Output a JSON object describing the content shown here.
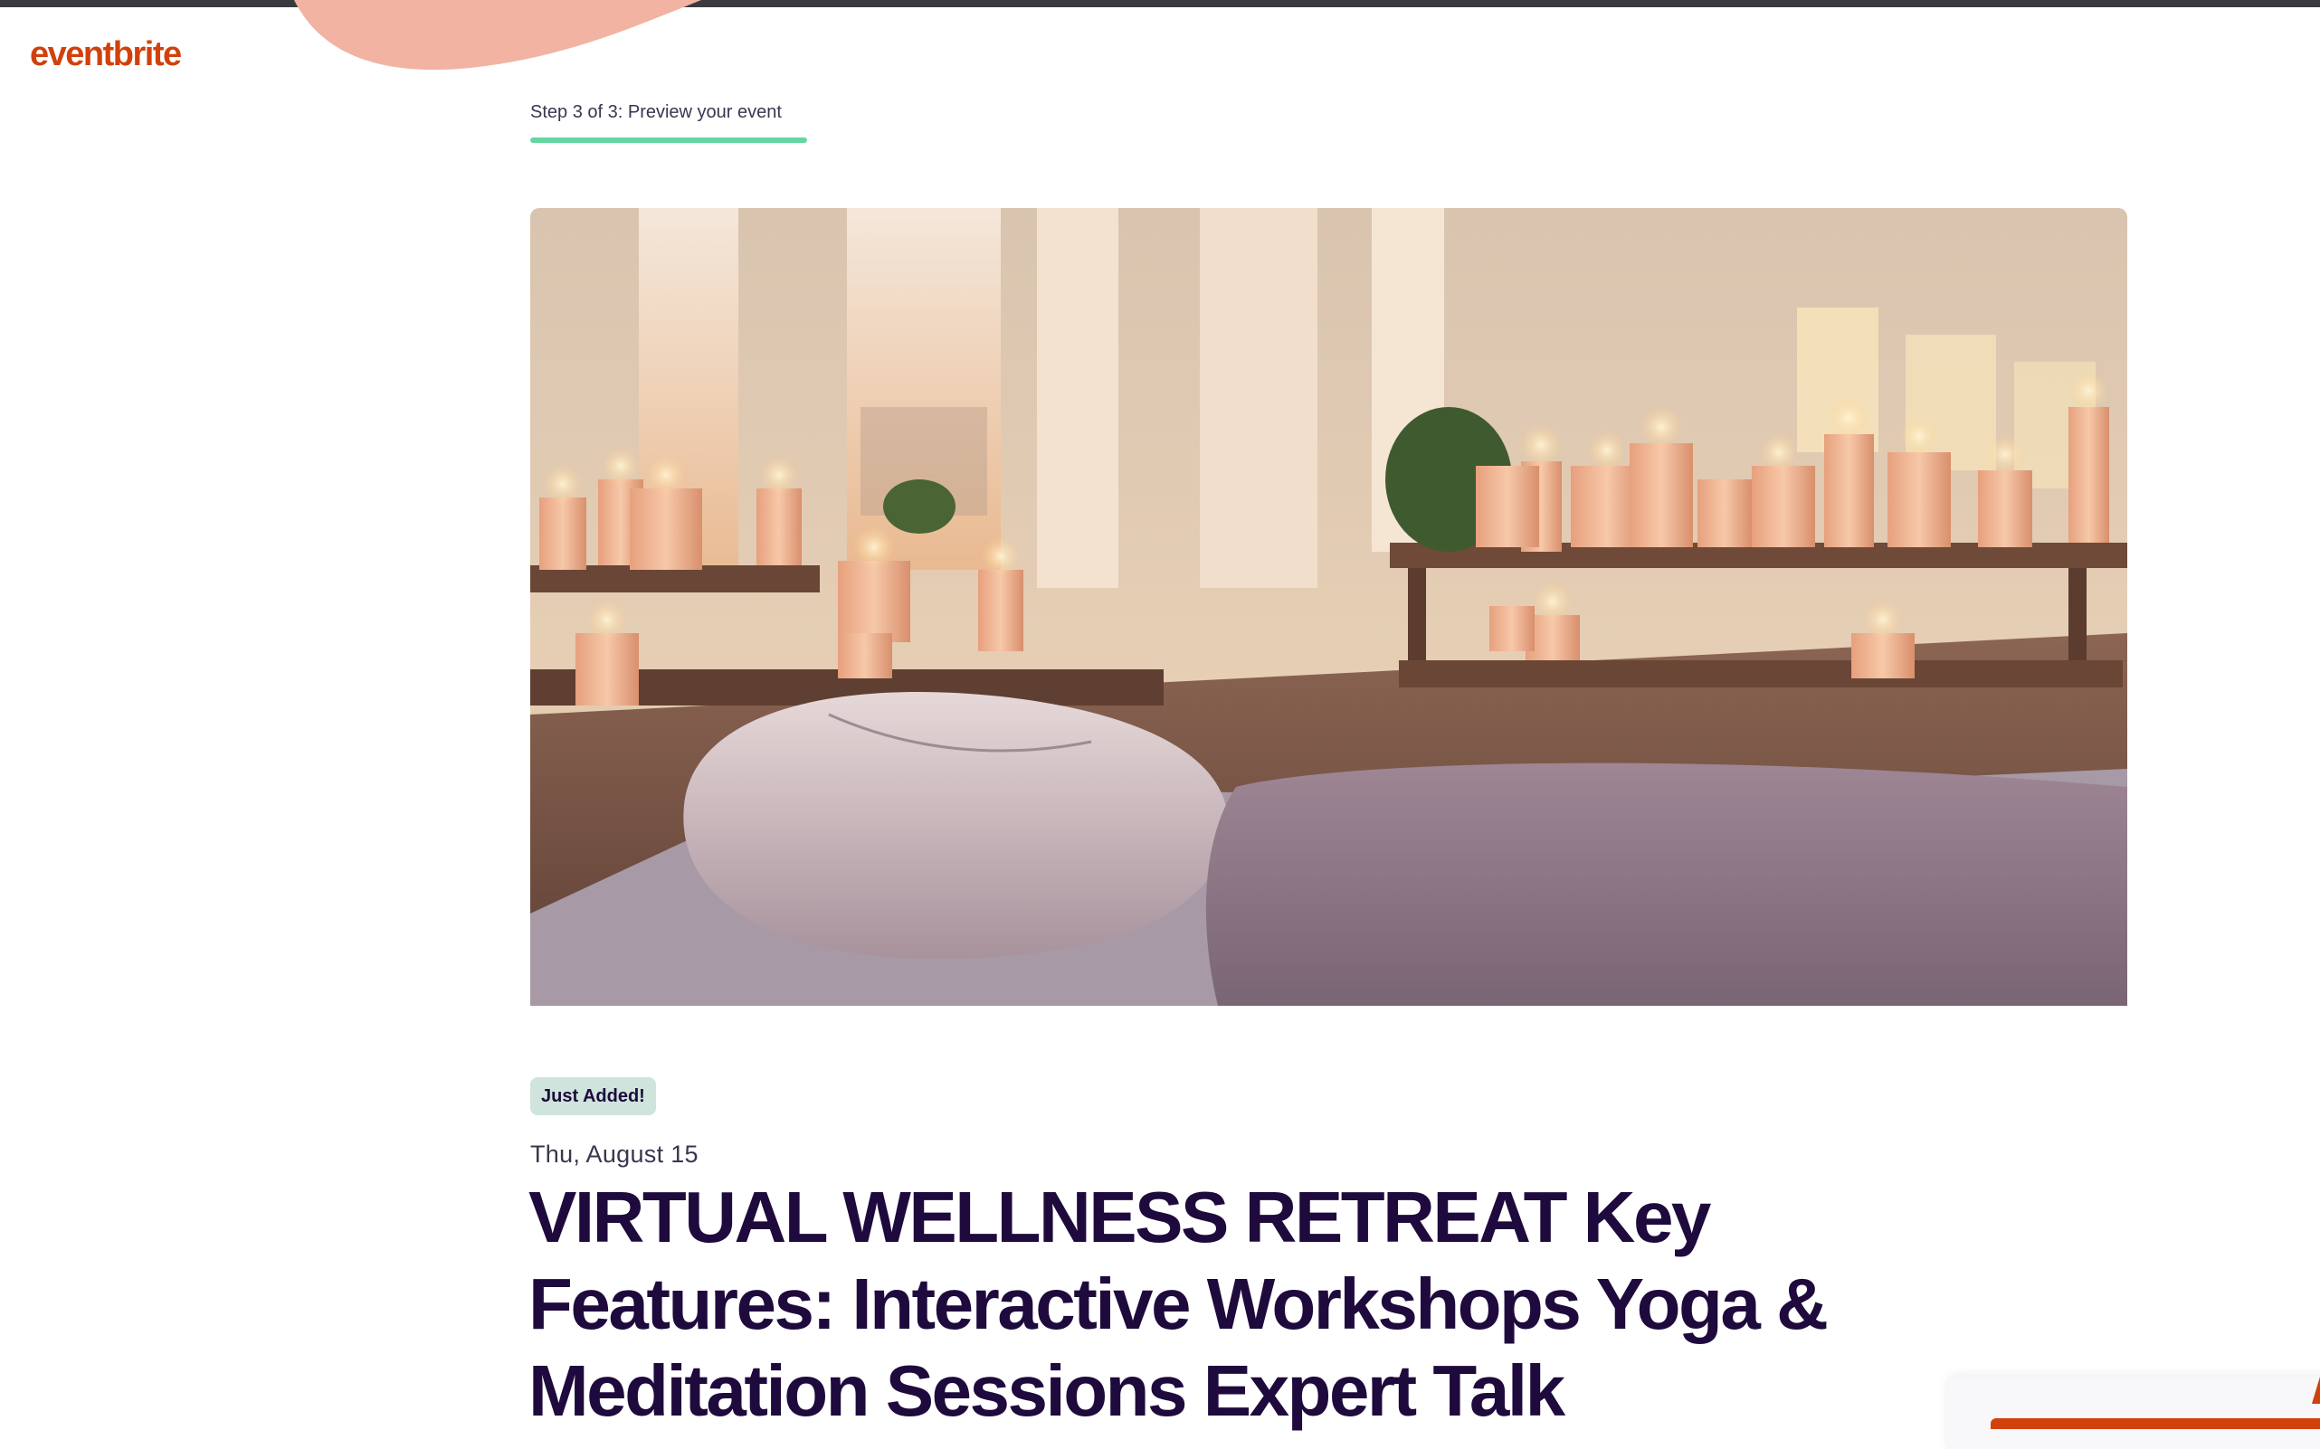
{
  "brand": {
    "logo_text": "eventbrite",
    "color": "#d1410c"
  },
  "progress": {
    "label": "Step 3 of 3: Preview your event",
    "current_step": 3,
    "total_steps": 3,
    "fraction": 1.0,
    "color": "#65d6a2"
  },
  "hero": {
    "alt": "Candle-lit wellness room with floor cushions"
  },
  "event": {
    "badge": "Just Added!",
    "date": "Thu, August 15",
    "title": "VIRTUAL WELLNESS RETREAT Key Features: Interactive Workshops Yoga & Meditation Sessions Expert Talk"
  },
  "colors": {
    "top_bar": "#3a3b3e",
    "accent_blob": "#f2b3a3",
    "badge_bg": "#cfe4dc",
    "title_text": "#1e0a3c"
  }
}
